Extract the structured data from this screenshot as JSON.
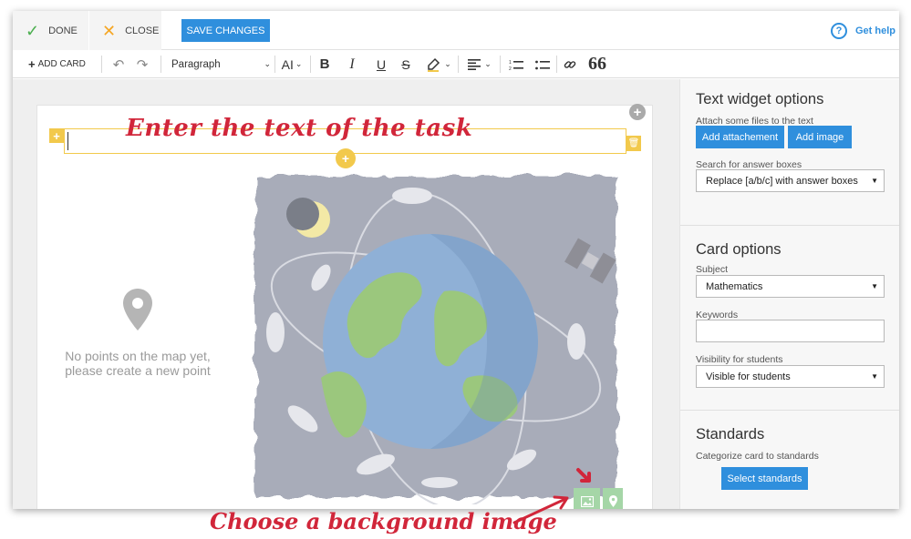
{
  "topbar": {
    "done_label": "DONE",
    "close_label": "CLOSE",
    "save_label": "SAVE CHANGES",
    "help_label": "Get help"
  },
  "toolbar": {
    "add_card_label": "ADD CARD",
    "paragraph_label": "Paragraph",
    "font_size_label": "AI",
    "bold_label": "B",
    "italic_label": "I",
    "underline_label": "U",
    "strike_label": "S",
    "quote_label": "66"
  },
  "canvas": {
    "empty_line1": "No points on the map yet,",
    "empty_line2": "please create a new point"
  },
  "sidebar": {
    "text_widget": {
      "title": "Text widget options",
      "attach_label": "Attach some files to the text",
      "add_attachment_label": "Add attachement",
      "add_image_label": "Add image",
      "search_label": "Search for answer boxes",
      "search_value": "Replace [a/b/c] with answer boxes"
    },
    "card_options": {
      "title": "Card options",
      "subject_label": "Subject",
      "subject_value": "Mathematics",
      "keywords_label": "Keywords",
      "keywords_value": "",
      "visibility_label": "Visibility for students",
      "visibility_value": "Visible for students"
    },
    "standards": {
      "title": "Standards",
      "categorize_label": "Categorize card to standards",
      "select_label": "Select standards"
    }
  },
  "annotations": {
    "top": "Enter the text of the task",
    "bottom": "Choose a background image"
  },
  "colors": {
    "accent": "#2f8fdd",
    "done": "#4caf50",
    "close": "#f5a623",
    "widget": "#f2c94c",
    "map_btn": "#a5d6a7",
    "annotation": "#d1263a"
  }
}
